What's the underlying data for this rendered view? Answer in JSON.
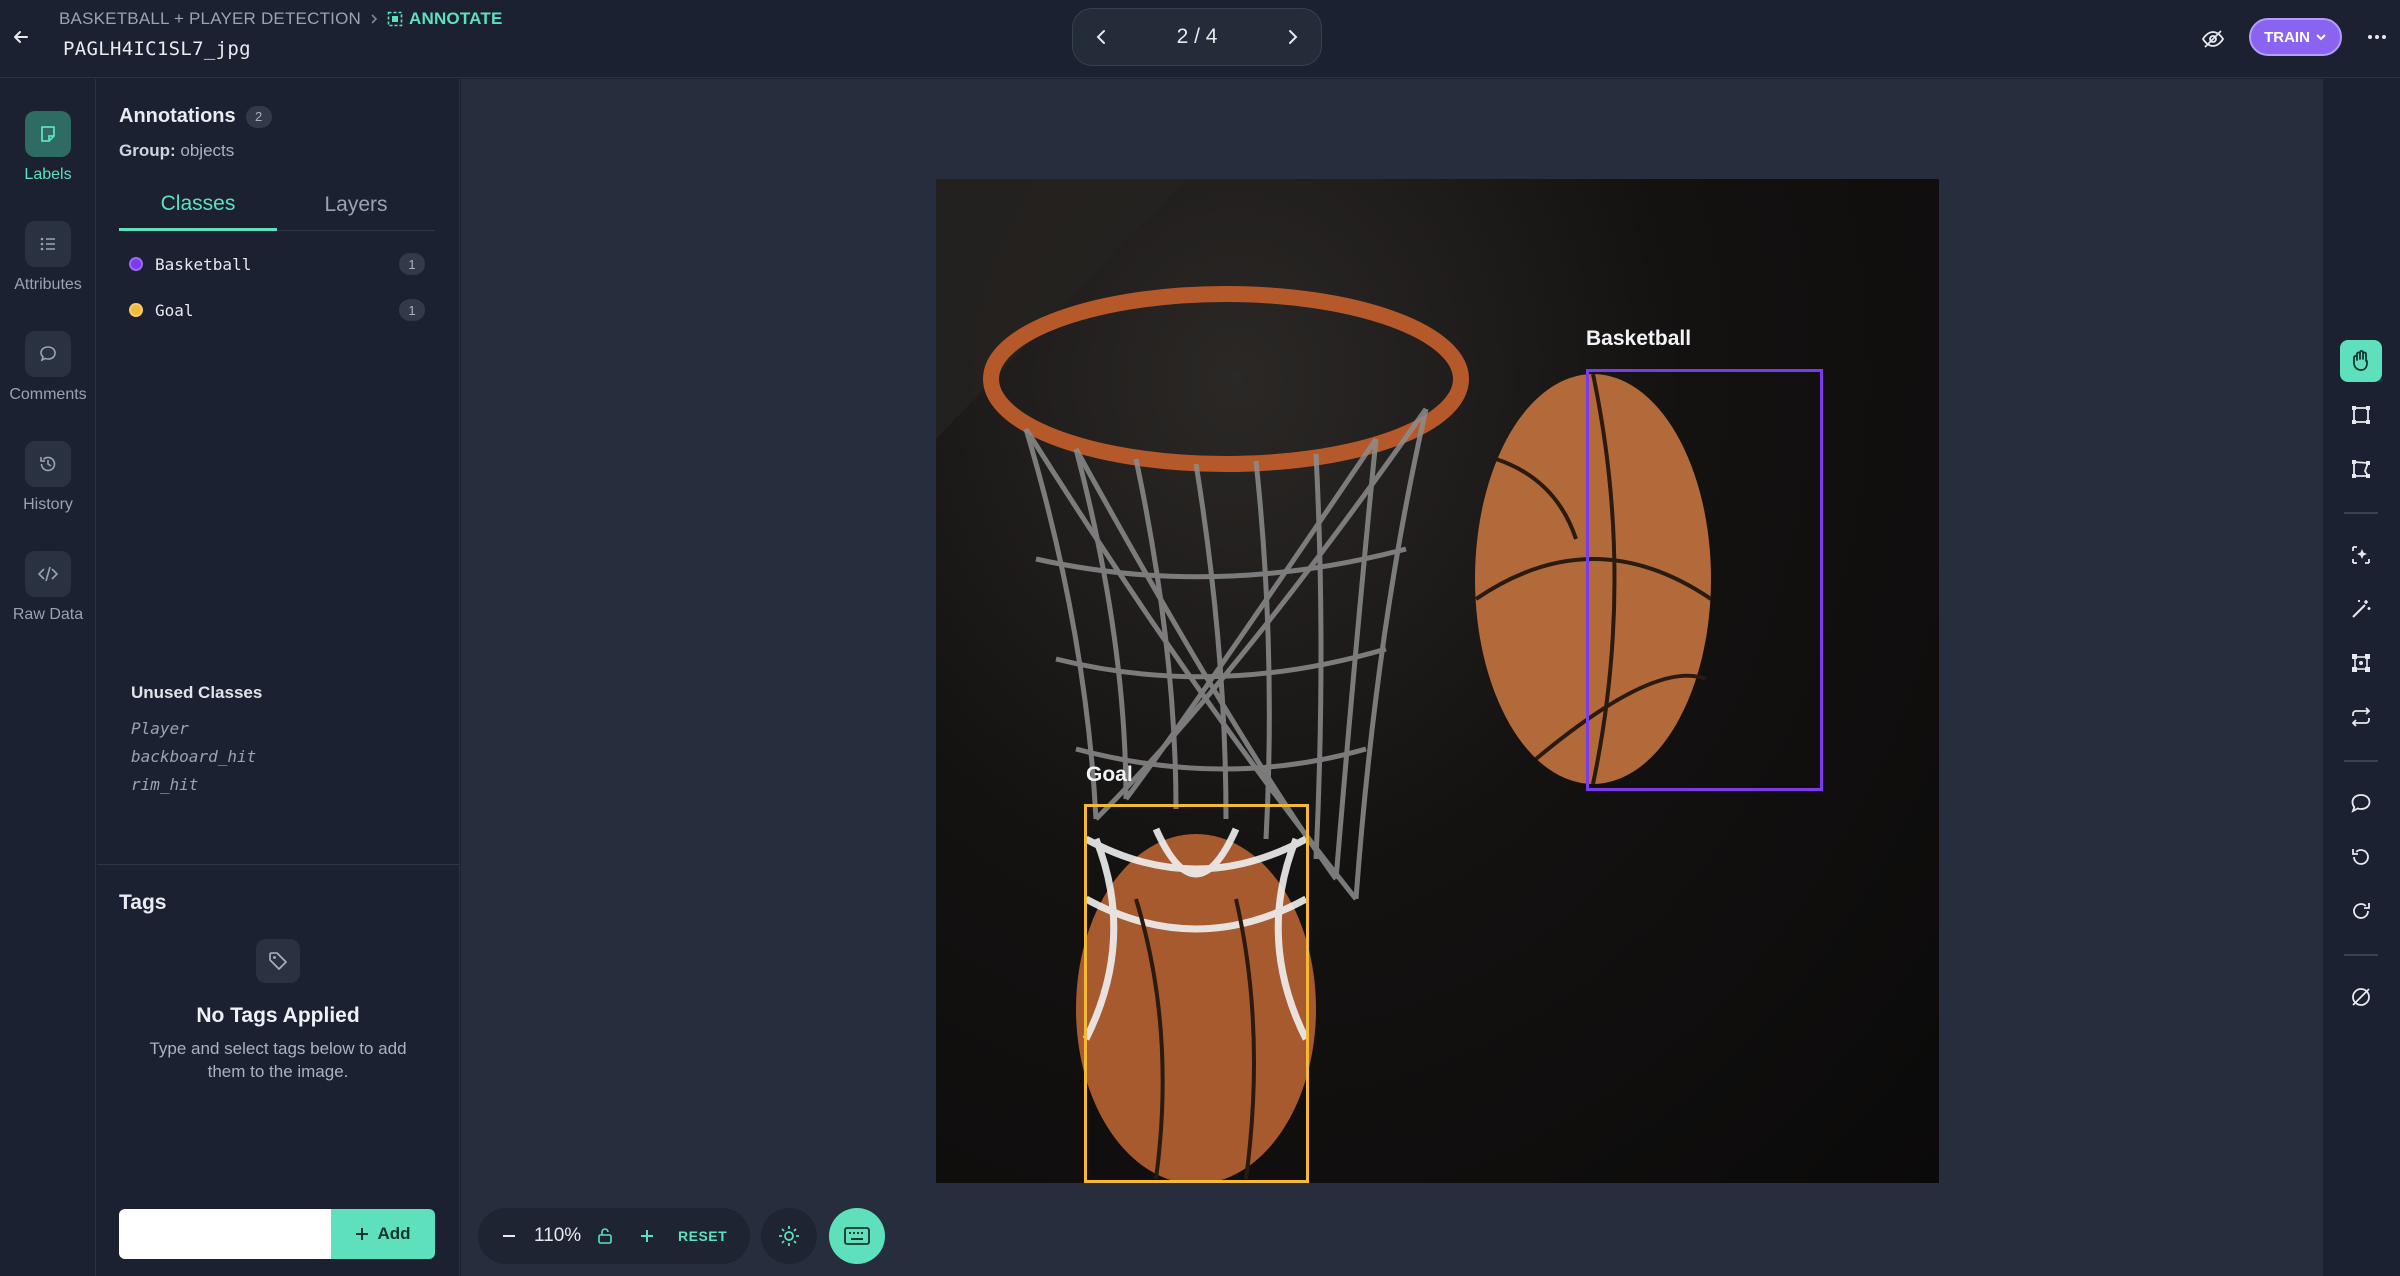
{
  "header": {
    "breadcrumb_project": "BASKETBALL + PLAYER DETECTION",
    "breadcrumb_current": "ANNOTATE",
    "filename": "PAGLH4IC1SL7_jpg",
    "pager_text": "2 / 4",
    "train_label": "TRAIN"
  },
  "rail": {
    "items": [
      {
        "label": "Labels",
        "icon": "note-icon",
        "active": true
      },
      {
        "label": "Attributes",
        "icon": "list-icon"
      },
      {
        "label": "Comments",
        "icon": "comment-icon"
      },
      {
        "label": "History",
        "icon": "history-icon"
      },
      {
        "label": "Raw Data",
        "icon": "code-icon"
      }
    ]
  },
  "panel": {
    "title": "Annotations",
    "annotation_count": "2",
    "group_label": "Group:",
    "group_value": "objects",
    "tabs": [
      "Classes",
      "Layers"
    ],
    "classes": [
      {
        "name": "Basketball",
        "count": "1",
        "color": "#7c3aed"
      },
      {
        "name": "Goal",
        "count": "1",
        "color": "#f5b93a"
      }
    ],
    "unused_title": "Unused Classes",
    "unused": [
      "Player",
      "backboard_hit",
      "rim_hit"
    ],
    "tags_title": "Tags",
    "no_tags_title": "No Tags Applied",
    "no_tags_sub": "Type and select tags below to add them to the image.",
    "tag_input_placeholder": "",
    "add_label": "Add"
  },
  "canvas": {
    "annotations": [
      {
        "label": "Basketball",
        "color": "#7c3aed"
      },
      {
        "label": "Goal",
        "color": "#f5b93a"
      }
    ]
  },
  "zoom": {
    "value": "110%",
    "reset_label": "RESET"
  },
  "colors": {
    "accent": "#5ee0bd",
    "train": "#8a63f0",
    "basketball": "#7c3aed",
    "goal": "#f5b93a"
  }
}
